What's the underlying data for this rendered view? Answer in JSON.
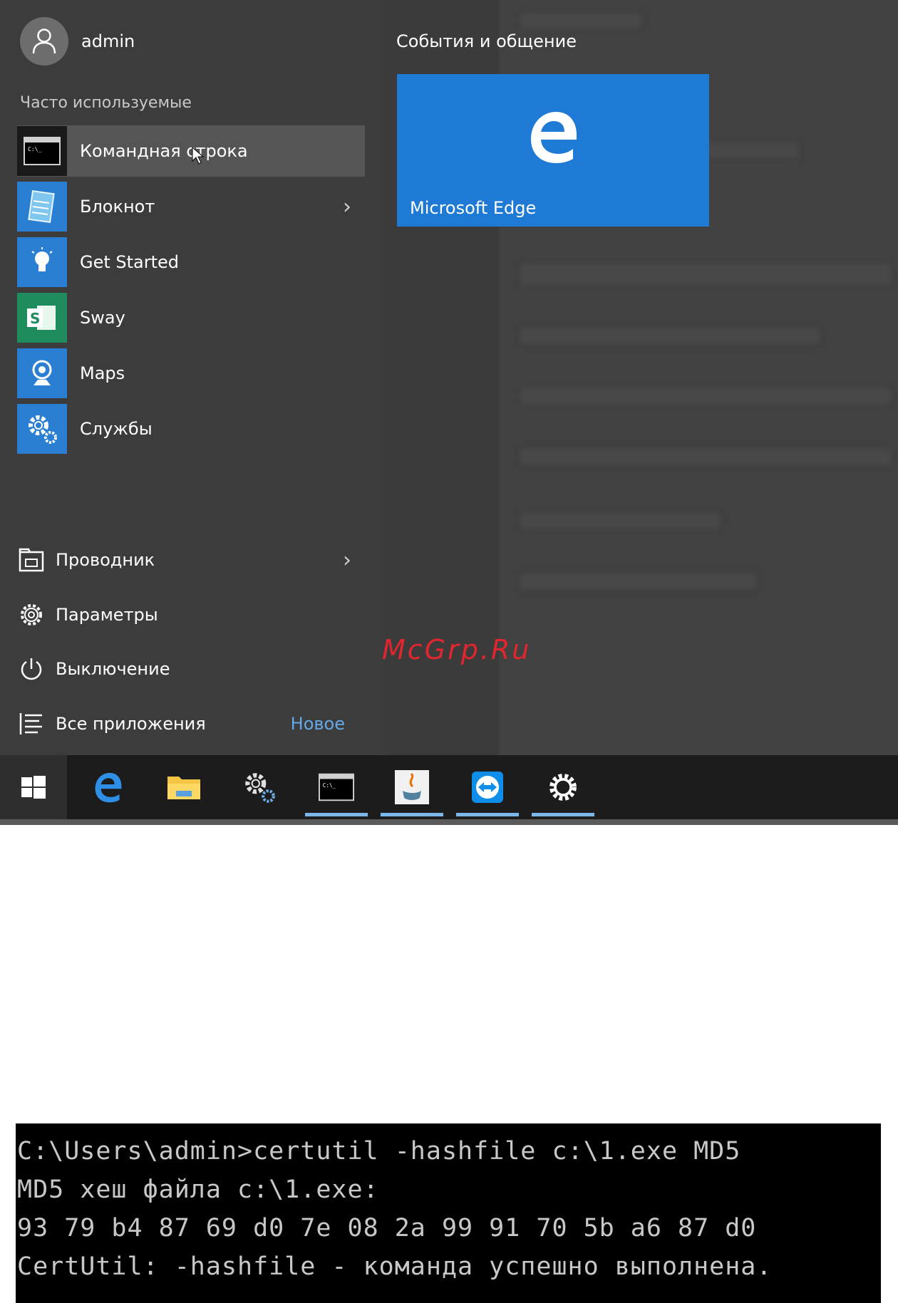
{
  "user": {
    "name": "admin",
    "avatar_icon": "user-avatar-icon"
  },
  "left_menu": {
    "section_title": "Часто используемые",
    "apps": [
      {
        "label": "Командная строка",
        "icon": "command-prompt-icon",
        "has_submenu": false,
        "highlighted": true
      },
      {
        "label": "Блокнот",
        "icon": "notepad-icon",
        "has_submenu": true,
        "highlighted": false
      },
      {
        "label": "Get Started",
        "icon": "lightbulb-icon",
        "has_submenu": false,
        "highlighted": false
      },
      {
        "label": "Sway",
        "icon": "sway-icon",
        "has_submenu": false,
        "highlighted": false
      },
      {
        "label": "Maps",
        "icon": "maps-icon",
        "has_submenu": false,
        "highlighted": false
      },
      {
        "label": "Службы",
        "icon": "services-gear-icon",
        "has_submenu": false,
        "highlighted": false
      }
    ],
    "system_items": [
      {
        "label": "Проводник",
        "icon": "file-explorer-icon",
        "has_submenu": true
      },
      {
        "label": "Параметры",
        "icon": "settings-gear-icon",
        "has_submenu": false
      },
      {
        "label": "Выключение",
        "icon": "power-icon",
        "has_submenu": false
      },
      {
        "label": "Все приложения",
        "icon": "all-apps-list-icon",
        "has_submenu": false,
        "badge": "Новое"
      }
    ]
  },
  "tiles": {
    "group_title": "События и общение",
    "edge_tile": {
      "label": "Microsoft Edge",
      "color": "#1f7ad6"
    }
  },
  "watermark": "McGrp.Ru",
  "taskbar": {
    "items": [
      {
        "name": "windows-start",
        "icon": "windows-logo-icon",
        "running": false
      },
      {
        "name": "edge",
        "icon": "edge-icon",
        "running": false
      },
      {
        "name": "file-explorer",
        "icon": "folder-icon",
        "running": false
      },
      {
        "name": "services",
        "icon": "gears-icon",
        "running": false
      },
      {
        "name": "command-prompt",
        "icon": "cmd-icon",
        "running": true
      },
      {
        "name": "java",
        "icon": "java-icon",
        "running": true
      },
      {
        "name": "teamviewer",
        "icon": "teamviewer-icon",
        "running": true
      },
      {
        "name": "settings",
        "icon": "settings-gear-icon",
        "running": true
      }
    ]
  },
  "console": {
    "lines": [
      "C:\\Users\\admin>certutil -hashfile c:\\1.exe MD5",
      "MD5 хеш файла c:\\1.exe:",
      "93 79 b4 87 69 d0 7e 08 2a 99 91 70 5b a6 87 d0",
      "CertUtil: -hashfile - команда успешно выполнена."
    ]
  }
}
